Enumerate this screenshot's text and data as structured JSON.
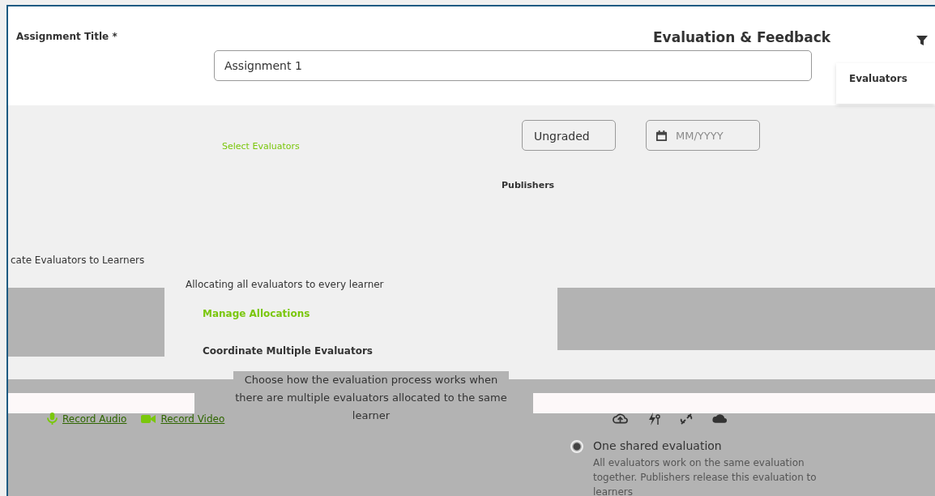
{
  "form": {
    "title_label": "Assignment Title *",
    "title_value": "Assignment 1",
    "select_evaluators": "Select Evaluators",
    "grading": "Ungraded",
    "date_placeholder": "MM/YYYY",
    "publishers_label": "Publishers"
  },
  "side_panel": {
    "title": "Evaluation & Feedback",
    "evaluators_label": "Evaluators"
  },
  "allocation": {
    "heading": "cate Evaluators to Learners",
    "summary": "Allocating all evaluators to every learner",
    "manage_link": "Manage Allocations"
  },
  "dialog": {
    "title": "Coordinate Multiple Evaluators",
    "intro": "Choose how the evaluation process works when there are multiple evaluators allocated to the same learner",
    "options": [
      {
        "label": "One shared evaluation",
        "description": "All evaluators work on the same evaluation together. Publishers release this evaluation to learners",
        "selected": true
      }
    ]
  },
  "media_links": [
    {
      "kind": "audio",
      "label": "Record Audio"
    },
    {
      "kind": "video",
      "label": "Record Video"
    }
  ]
}
